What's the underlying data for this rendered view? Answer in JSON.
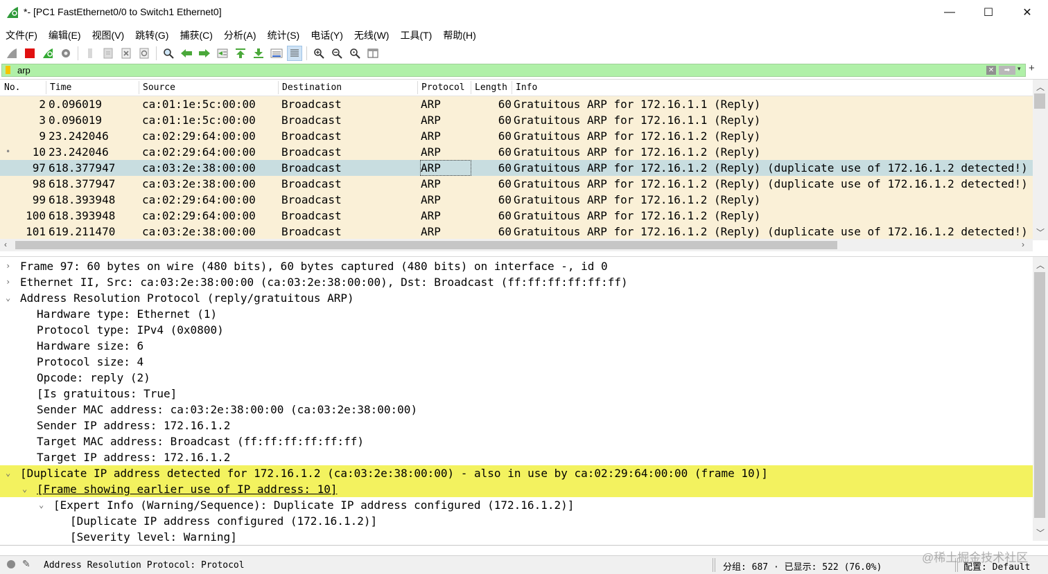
{
  "window": {
    "title": "*- [PC1 FastEthernet0/0 to Switch1 Ethernet0]",
    "minimize": "—",
    "maximize": "☐",
    "close": "✕"
  },
  "menu": [
    "文件(F)",
    "编辑(E)",
    "视图(V)",
    "跳转(G)",
    "捕获(C)",
    "分析(A)",
    "统计(S)",
    "电话(Y)",
    "无线(W)",
    "工具(T)",
    "帮助(H)"
  ],
  "filter": {
    "value": "arp",
    "clear_glyph": "✕",
    "apply_glyph": "➡",
    "dropdown_glyph": "▾",
    "add_glyph": "+"
  },
  "columns": [
    "No.",
    "Time",
    "Source",
    "Destination",
    "Protocol",
    "Length",
    "Info"
  ],
  "packets": [
    {
      "no": "2",
      "time": "0.096019",
      "source": "ca:01:1e:5c:00:00",
      "destination": "Broadcast",
      "protocol": "ARP",
      "length": "60",
      "info": "Gratuitous ARP for 172.16.1.1 (Reply)",
      "selected": false,
      "mark": ""
    },
    {
      "no": "3",
      "time": "0.096019",
      "source": "ca:01:1e:5c:00:00",
      "destination": "Broadcast",
      "protocol": "ARP",
      "length": "60",
      "info": "Gratuitous ARP for 172.16.1.1 (Reply)",
      "selected": false,
      "mark": ""
    },
    {
      "no": "9",
      "time": "23.242046",
      "source": "ca:02:29:64:00:00",
      "destination": "Broadcast",
      "protocol": "ARP",
      "length": "60",
      "info": "Gratuitous ARP for 172.16.1.2 (Reply)",
      "selected": false,
      "mark": ""
    },
    {
      "no": "10",
      "time": "23.242046",
      "source": "ca:02:29:64:00:00",
      "destination": "Broadcast",
      "protocol": "ARP",
      "length": "60",
      "info": "Gratuitous ARP for 172.16.1.2 (Reply)",
      "selected": false,
      "mark": "•"
    },
    {
      "no": "97",
      "time": "618.377947",
      "source": "ca:03:2e:38:00:00",
      "destination": "Broadcast",
      "protocol": "ARP",
      "length": "60",
      "info": "Gratuitous ARP for 172.16.1.2 (Reply) (duplicate use of 172.16.1.2 detected!)",
      "selected": true,
      "mark": ""
    },
    {
      "no": "98",
      "time": "618.377947",
      "source": "ca:03:2e:38:00:00",
      "destination": "Broadcast",
      "protocol": "ARP",
      "length": "60",
      "info": "Gratuitous ARP for 172.16.1.2 (Reply) (duplicate use of 172.16.1.2 detected!)",
      "selected": false,
      "mark": ""
    },
    {
      "no": "99",
      "time": "618.393948",
      "source": "ca:02:29:64:00:00",
      "destination": "Broadcast",
      "protocol": "ARP",
      "length": "60",
      "info": "Gratuitous ARP for 172.16.1.2 (Reply)",
      "selected": false,
      "mark": ""
    },
    {
      "no": "100",
      "time": "618.393948",
      "source": "ca:02:29:64:00:00",
      "destination": "Broadcast",
      "protocol": "ARP",
      "length": "60",
      "info": "Gratuitous ARP for 172.16.1.2 (Reply)",
      "selected": false,
      "mark": ""
    },
    {
      "no": "101",
      "time": "619.211470",
      "source": "ca:03:2e:38:00:00",
      "destination": "Broadcast",
      "protocol": "ARP",
      "length": "60",
      "info": "Gratuitous ARP for 172.16.1.2 (Reply) (duplicate use of 172.16.1.2 detected!)",
      "selected": false,
      "mark": ""
    }
  ],
  "details": [
    {
      "text": "Frame 97: 60 bytes on wire (480 bits), 60 bytes captured (480 bits) on interface -, id 0",
      "indent": 0,
      "arrow": "›",
      "highlight": false,
      "link": false
    },
    {
      "text": "Ethernet II, Src: ca:03:2e:38:00:00 (ca:03:2e:38:00:00), Dst: Broadcast (ff:ff:ff:ff:ff:ff)",
      "indent": 0,
      "arrow": "›",
      "highlight": false,
      "link": false
    },
    {
      "text": "Address Resolution Protocol (reply/gratuitous ARP)",
      "indent": 0,
      "arrow": "⌄",
      "highlight": false,
      "link": false
    },
    {
      "text": "Hardware type: Ethernet (1)",
      "indent": 1,
      "arrow": "",
      "highlight": false,
      "link": false
    },
    {
      "text": "Protocol type: IPv4 (0x0800)",
      "indent": 1,
      "arrow": "",
      "highlight": false,
      "link": false
    },
    {
      "text": "Hardware size: 6",
      "indent": 1,
      "arrow": "",
      "highlight": false,
      "link": false
    },
    {
      "text": "Protocol size: 4",
      "indent": 1,
      "arrow": "",
      "highlight": false,
      "link": false
    },
    {
      "text": "Opcode: reply (2)",
      "indent": 1,
      "arrow": "",
      "highlight": false,
      "link": false
    },
    {
      "text": "[Is gratuitous: True]",
      "indent": 1,
      "arrow": "",
      "highlight": false,
      "link": false
    },
    {
      "text": "Sender MAC address: ca:03:2e:38:00:00 (ca:03:2e:38:00:00)",
      "indent": 1,
      "arrow": "",
      "highlight": false,
      "link": false
    },
    {
      "text": "Sender IP address: 172.16.1.2",
      "indent": 1,
      "arrow": "",
      "highlight": false,
      "link": false
    },
    {
      "text": "Target MAC address: Broadcast (ff:ff:ff:ff:ff:ff)",
      "indent": 1,
      "arrow": "",
      "highlight": false,
      "link": false
    },
    {
      "text": "Target IP address: 172.16.1.2",
      "indent": 1,
      "arrow": "",
      "highlight": false,
      "link": false
    },
    {
      "text": "[Duplicate IP address detected for 172.16.1.2 (ca:03:2e:38:00:00) - also in use by ca:02:29:64:00:00 (frame 10)]",
      "indent": 0,
      "arrow": "⌄",
      "highlight": true,
      "link": false
    },
    {
      "text": "[Frame showing earlier use of IP address: 10]",
      "indent": 1,
      "arrow": "⌄",
      "highlight": true,
      "link": true
    },
    {
      "text": "[Expert Info (Warning/Sequence): Duplicate IP address configured (172.16.1.2)]",
      "indent": 2,
      "arrow": "⌄",
      "highlight": false,
      "link": false
    },
    {
      "text": "[Duplicate IP address configured (172.16.1.2)]",
      "indent": 3,
      "arrow": "",
      "highlight": false,
      "link": false
    },
    {
      "text": "[Severity level: Warning]",
      "indent": 3,
      "arrow": "",
      "highlight": false,
      "link": false
    }
  ],
  "status": {
    "protocol_text": "Address Resolution Protocol: Protocol",
    "packets_text": "分组: 687 · 已显示: 522 (76.0%)",
    "profile_text": "配置: Default",
    "watermark": "@稀土掘金技术社区"
  },
  "colors": {
    "row_bg": "#faf0d7",
    "row_selected_bg": "#c8dde0",
    "filter_valid_bg": "#b0f0a8",
    "highlight_yellow": "#f3f25f"
  }
}
